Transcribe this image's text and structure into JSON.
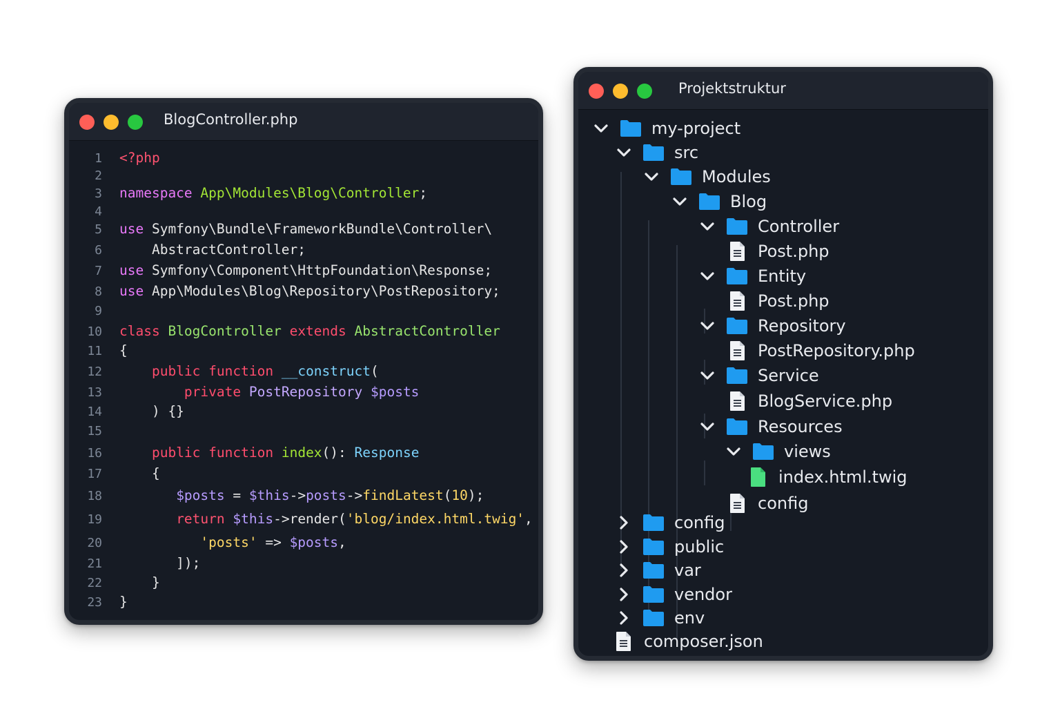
{
  "code_window": {
    "title": "BlogController.php",
    "line_numbers": [
      "1",
      "2",
      "3",
      "4",
      "5",
      "6",
      "7",
      "8",
      "9",
      "10",
      "11",
      "12",
      "13",
      "14",
      "15",
      "16",
      "17",
      "18",
      "19",
      "20",
      "21",
      "22",
      "23"
    ],
    "lines": [
      [
        {
          "t": "<?php",
          "c": "c-tag"
        }
      ],
      [],
      [
        {
          "t": "namespace",
          "c": "c-kw"
        },
        {
          "t": " ",
          "c": "c-txt"
        },
        {
          "t": "App\\Modules\\Blog\\Controller",
          "c": "c-ns"
        },
        {
          "t": ";",
          "c": "c-txt"
        }
      ],
      [],
      [
        {
          "t": "use",
          "c": "c-kw"
        },
        {
          "t": " Symfony\\Bundle\\FrameworkBundle\\Controller\\",
          "c": "c-txt"
        }
      ],
      [
        {
          "t": "    AbstractController;",
          "c": "c-txt"
        }
      ],
      [
        {
          "t": "use",
          "c": "c-kw"
        },
        {
          "t": " Symfony\\Component\\HttpFoundation\\Response;",
          "c": "c-txt"
        }
      ],
      [
        {
          "t": "use",
          "c": "c-kw"
        },
        {
          "t": " App\\Modules\\Blog\\Repository\\PostRepository;",
          "c": "c-txt"
        }
      ],
      [],
      [
        {
          "t": "class",
          "c": "c-kw2"
        },
        {
          "t": " ",
          "c": "c-txt"
        },
        {
          "t": "BlogController",
          "c": "c-cls"
        },
        {
          "t": " ",
          "c": "c-txt"
        },
        {
          "t": "extends",
          "c": "c-kw2"
        },
        {
          "t": " ",
          "c": "c-txt"
        },
        {
          "t": "AbstractController",
          "c": "c-cls"
        }
      ],
      [
        {
          "t": "{",
          "c": "c-txt"
        }
      ],
      [
        {
          "t": "    ",
          "c": "c-txt"
        },
        {
          "t": "public",
          "c": "c-kw2"
        },
        {
          "t": " ",
          "c": "c-txt"
        },
        {
          "t": "function",
          "c": "c-kw2"
        },
        {
          "t": " ",
          "c": "c-txt"
        },
        {
          "t": "__construct",
          "c": "c-fn"
        },
        {
          "t": "(",
          "c": "c-txt"
        }
      ],
      [
        {
          "t": "        ",
          "c": "c-txt"
        },
        {
          "t": "private",
          "c": "c-kw2"
        },
        {
          "t": " ",
          "c": "c-txt"
        },
        {
          "t": "PostRepository",
          "c": "c-type"
        },
        {
          "t": " ",
          "c": "c-txt"
        },
        {
          "t": "$posts",
          "c": "c-var"
        }
      ],
      [
        {
          "t": "    ) {}",
          "c": "c-txt"
        }
      ],
      [],
      [
        {
          "t": "    ",
          "c": "c-txt"
        },
        {
          "t": "public",
          "c": "c-kw2"
        },
        {
          "t": " ",
          "c": "c-txt"
        },
        {
          "t": "function",
          "c": "c-kw2"
        },
        {
          "t": " ",
          "c": "c-txt"
        },
        {
          "t": "index",
          "c": "c-idx"
        },
        {
          "t": "(): ",
          "c": "c-txt"
        },
        {
          "t": "Response",
          "c": "c-fn"
        }
      ],
      [
        {
          "t": "    {",
          "c": "c-txt"
        }
      ],
      [
        {
          "t": "       ",
          "c": "c-txt"
        },
        {
          "t": "$posts",
          "c": "c-var"
        },
        {
          "t": " = ",
          "c": "c-txt"
        },
        {
          "t": "$this",
          "c": "c-var"
        },
        {
          "t": "->",
          "c": "c-txt"
        },
        {
          "t": "posts",
          "c": "c-var"
        },
        {
          "t": "->",
          "c": "c-txt"
        },
        {
          "t": "findLatest",
          "c": "c-call"
        },
        {
          "t": "(",
          "c": "c-txt"
        },
        {
          "t": "10",
          "c": "c-num"
        },
        {
          "t": ");",
          "c": "c-txt"
        }
      ],
      [
        {
          "t": "       ",
          "c": "c-txt"
        },
        {
          "t": "return",
          "c": "c-ret"
        },
        {
          "t": " ",
          "c": "c-txt"
        },
        {
          "t": "$this",
          "c": "c-var"
        },
        {
          "t": "->render(",
          "c": "c-txt"
        },
        {
          "t": "'blog/index.html.twig'",
          "c": "c-str"
        },
        {
          "t": ", [",
          "c": "c-txt"
        }
      ],
      [
        {
          "t": "          ",
          "c": "c-txt"
        },
        {
          "t": "'posts'",
          "c": "c-str"
        },
        {
          "t": " => ",
          "c": "c-txt"
        },
        {
          "t": "$posts",
          "c": "c-var"
        },
        {
          "t": ",",
          "c": "c-txt"
        }
      ],
      [
        {
          "t": "       ]);",
          "c": "c-txt"
        }
      ],
      [
        {
          "t": "    }",
          "c": "c-txt"
        }
      ],
      [
        {
          "t": "}",
          "c": "c-txt"
        }
      ]
    ]
  },
  "tree_window": {
    "title": "Projektstruktur",
    "items": [
      {
        "label": "my-project",
        "type": "folder",
        "chevron": "down"
      },
      {
        "label": "src",
        "type": "folder",
        "chevron": "down"
      },
      {
        "label": "Modules",
        "type": "folder",
        "chevron": "down"
      },
      {
        "label": "Blog",
        "type": "folder",
        "chevron": "down"
      },
      {
        "label": "Controller",
        "type": "folder",
        "chevron": "down"
      },
      {
        "label": "Post.php",
        "type": "file",
        "chevron": "none"
      },
      {
        "label": "Entity",
        "type": "folder",
        "chevron": "down"
      },
      {
        "label": "Post.php",
        "type": "file",
        "chevron": "none"
      },
      {
        "label": "Repository",
        "type": "folder",
        "chevron": "down"
      },
      {
        "label": "PostRepository.php",
        "type": "file",
        "chevron": "none"
      },
      {
        "label": "Service",
        "type": "folder",
        "chevron": "down"
      },
      {
        "label": "BlogService.php",
        "type": "file",
        "chevron": "none"
      },
      {
        "label": "Resources",
        "type": "folder",
        "chevron": "down"
      },
      {
        "label": "views",
        "type": "folder",
        "chevron": "down"
      },
      {
        "label": "index.html.twig",
        "type": "twig-file",
        "chevron": "none"
      },
      {
        "label": "config",
        "type": "file",
        "chevron": "none"
      },
      {
        "label": "config",
        "type": "folder",
        "chevron": "right"
      },
      {
        "label": "public",
        "type": "folder",
        "chevron": "right"
      },
      {
        "label": "var",
        "type": "folder",
        "chevron": "right"
      },
      {
        "label": "vendor",
        "type": "folder",
        "chevron": "right"
      },
      {
        "label": "env",
        "type": "folder",
        "chevron": "right"
      },
      {
        "label": "composer.json",
        "type": "file",
        "chevron": "none"
      }
    ]
  },
  "colors": {
    "folder": "#1f9bf0",
    "twig_file": "#4ade80",
    "file": "#f1f3f6",
    "close": "#ff5f57",
    "minimize": "#febc2e",
    "maximize": "#28c840"
  }
}
